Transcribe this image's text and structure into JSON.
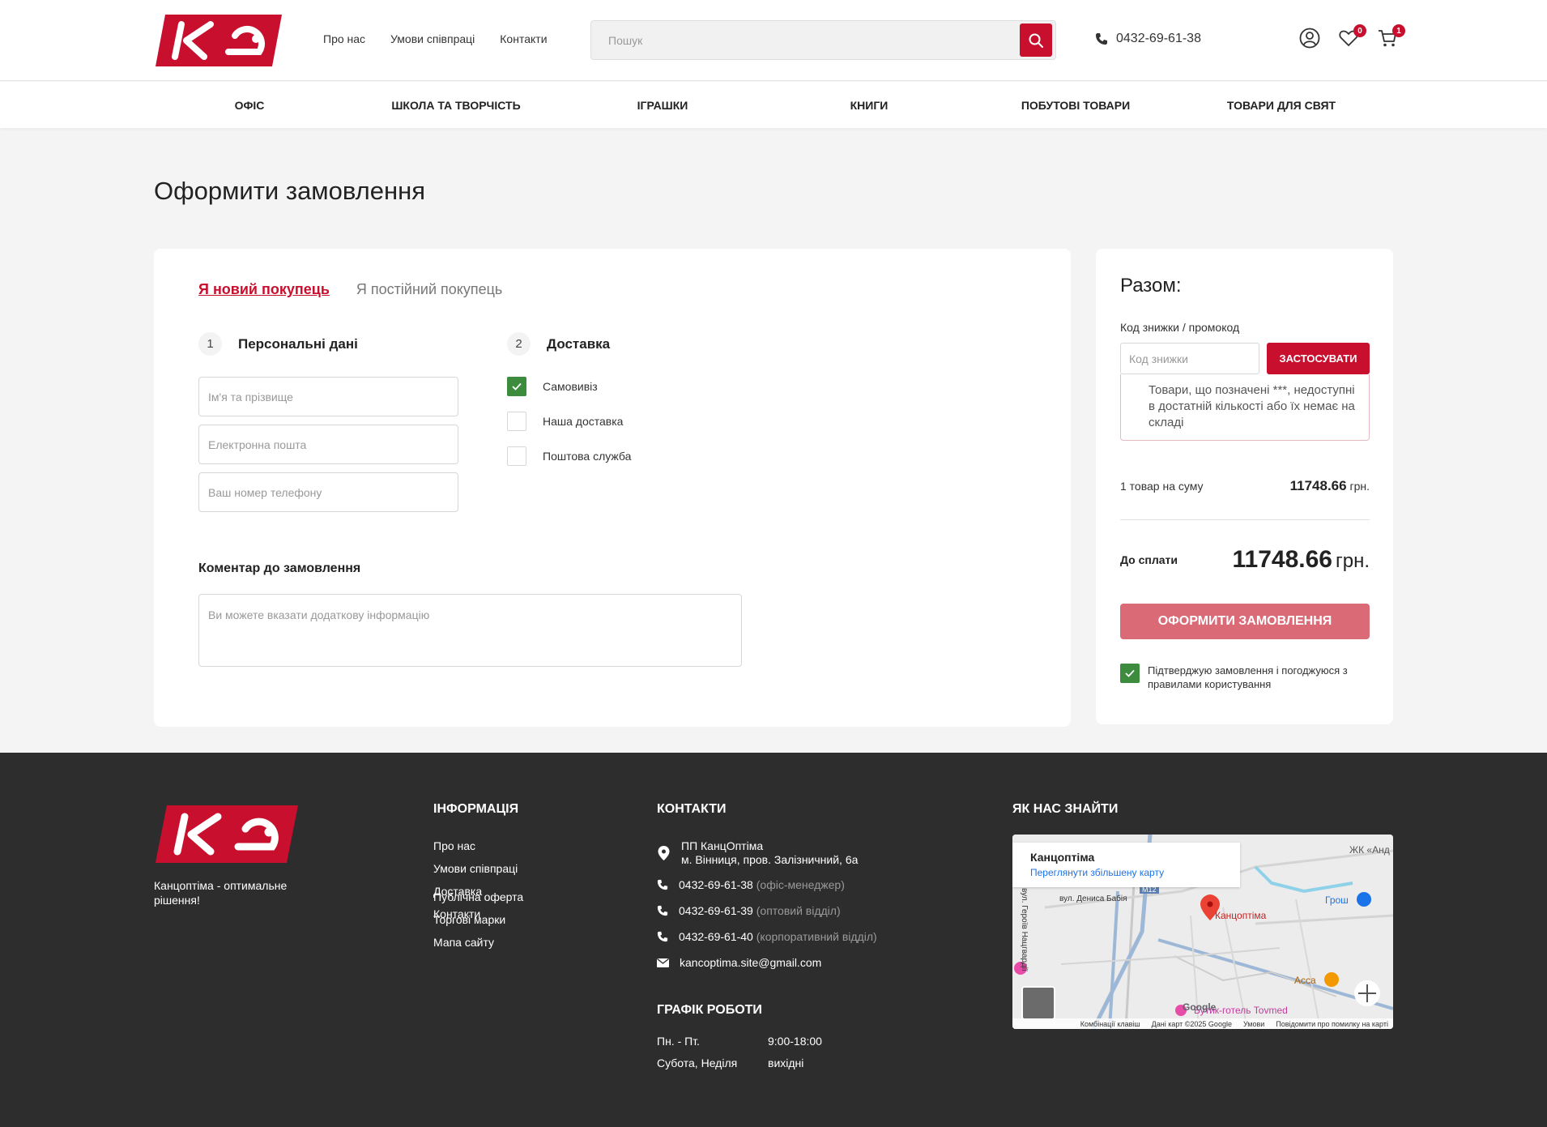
{
  "header": {
    "links": [
      "Про нас",
      "Умови співпраці",
      "Контакти"
    ],
    "search_placeholder": "Пошук",
    "phone": "0432-69-61-38",
    "wishlist_count": "0",
    "cart_count": "1"
  },
  "categories": [
    "ОФІС",
    "ШКОЛА ТА ТВОРЧІСТЬ",
    "ІГРАШКИ",
    "КНИГИ",
    "ПОБУТОВІ ТОВАРИ",
    "ТОВАРИ ДЛЯ СВЯТ"
  ],
  "page_title": "Оформити замовлення",
  "checkout": {
    "tab_new": "Я новий покупець",
    "tab_returning": "Я постійний покупець",
    "step1_num": "1",
    "step1_title": "Персональні дані",
    "name_placeholder": "Ім'я та прізвище",
    "email_placeholder": "Електронна пошта",
    "phone_placeholder": "Ваш номер телефону",
    "step2_num": "2",
    "step2_title": "Доставка",
    "delivery": [
      {
        "label": "Самовивіз",
        "checked": true
      },
      {
        "label": "Наша доставка",
        "checked": false
      },
      {
        "label": "Поштова служба",
        "checked": false
      }
    ],
    "comment_label": "Коментар до замовлення",
    "comment_placeholder": "Ви можете вказати додаткову інформацію"
  },
  "summary": {
    "title": "Разом:",
    "promo_label": "Код знижки / промокод",
    "promo_placeholder": "Код знижки",
    "promo_button": "ЗАСТОСУВАТИ",
    "warning": "Товари, що позначені ***, недоступні в достатній кількості або їх немає на складі",
    "items_label": "1 товар на суму",
    "items_amount": "11748.66",
    "currency": "грн.",
    "total_label": "До сплати",
    "total_amount": "11748.66",
    "order_button": "Оформити замовлення",
    "agree_text": "Підтверджую замовлення і погоджуюся з правилами користування"
  },
  "footer": {
    "tagline": "Канцоптіма - оптимальне рішення!",
    "info_title": "ІНФОРМАЦІЯ",
    "info_links": [
      "Про нас",
      "Умови співпраці",
      "Доставка",
      "Контакти"
    ],
    "info_links2": [
      "Публічна оферта",
      "Торгові марки",
      "Мапа сайту"
    ],
    "contacts_title": "КОНТАКТИ",
    "address_line1": "ПП КанцОптіма",
    "address_line2": "м. Вінниця, пров. Залізничний, 6а",
    "phones": [
      {
        "num": "0432-69-61-38",
        "note": "(офіс-менеджер)"
      },
      {
        "num": "0432-69-61-39",
        "note": "(оптовий відділ)"
      },
      {
        "num": "0432-69-61-40",
        "note": "(корпоративний відділ)"
      }
    ],
    "email": "kancoptima.site@gmail.com",
    "schedule_title": "ГРАФІК РОБОТИ",
    "schedule": [
      {
        "days": "Пн. - Пт.",
        "hours": "9:00-18:00"
      },
      {
        "days": "Субота, Неділя",
        "hours": "вихідні"
      }
    ],
    "find_title": "ЯК НАС ЗНАЙТИ",
    "map": {
      "place_name": "Канцоптіма",
      "enlarge_link": "Переглянути збільшену карту",
      "marker_label": "Канцоптіма",
      "street1": "вул. Дениса Бабія",
      "street2": "вул. Героїв Нацгвардії",
      "road": "М12",
      "poi1": "Грош",
      "poi2": "Асса",
      "poi3": "Бутик-готель Tovmed",
      "poi4": "ЖК «Анд",
      "google": "Google",
      "foot": [
        "Комбінації клавіш",
        "Дані карт ©2025 Google",
        "Умови",
        "Повідомити про помилку на карті"
      ]
    }
  },
  "colors": {
    "brand_red": "#c8102e",
    "order_button": "#db6a77",
    "check_green": "#3d8b3d",
    "footer_bg": "#2d2d2d"
  }
}
